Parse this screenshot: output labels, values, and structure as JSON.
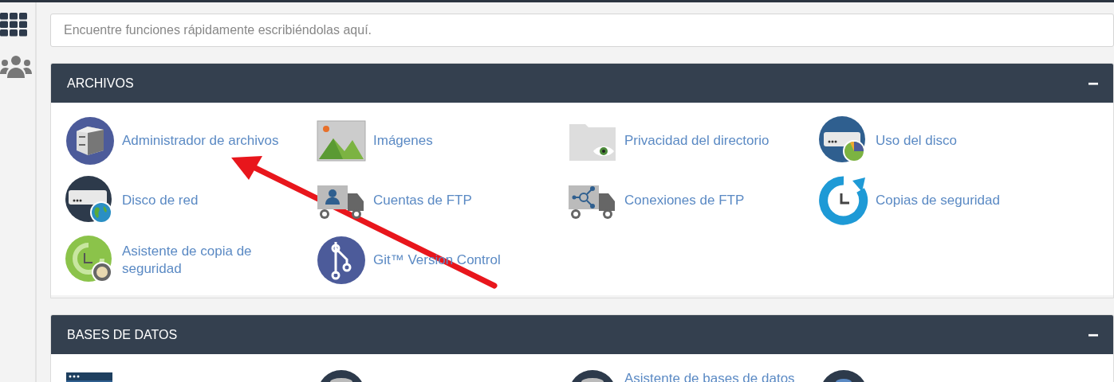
{
  "sidebar": {
    "items": [
      {
        "kind": "grid"
      },
      {
        "kind": "users"
      }
    ]
  },
  "search": {
    "placeholder": "Encuentre funciones rápidamente escribiéndolas aquí."
  },
  "panels": [
    {
      "title": "ARCHIVOS",
      "collapse": "−",
      "items": [
        {
          "label": "Administrador de archivos",
          "kind": "cabinet"
        },
        {
          "label": "Imágenes",
          "kind": "image"
        },
        {
          "label": "Privacidad del directorio",
          "kind": "folder-eye"
        },
        {
          "label": "Uso del disco",
          "kind": "disk-pie"
        },
        {
          "label": "Disco de red",
          "kind": "server-globe"
        },
        {
          "label": "Cuentas de FTP",
          "kind": "truck-user"
        },
        {
          "label": "Conexiones de FTP",
          "kind": "truck-network"
        },
        {
          "label": "Copias de seguridad",
          "kind": "clock-arrow"
        },
        {
          "label": "Asistente de copia de seguridad",
          "kind": "backup-wizard"
        },
        {
          "label": "Git™ Version Control",
          "kind": "git"
        }
      ]
    },
    {
      "title": "BASES DE DATOS",
      "collapse": "−",
      "items": [
        {
          "kind": "terminal"
        },
        {
          "kind": "database"
        },
        {
          "label": "Asistente de bases de datos",
          "kind": "database"
        },
        {
          "kind": "database-blue"
        }
      ]
    }
  ],
  "annotation": {
    "kind": "arrow"
  }
}
